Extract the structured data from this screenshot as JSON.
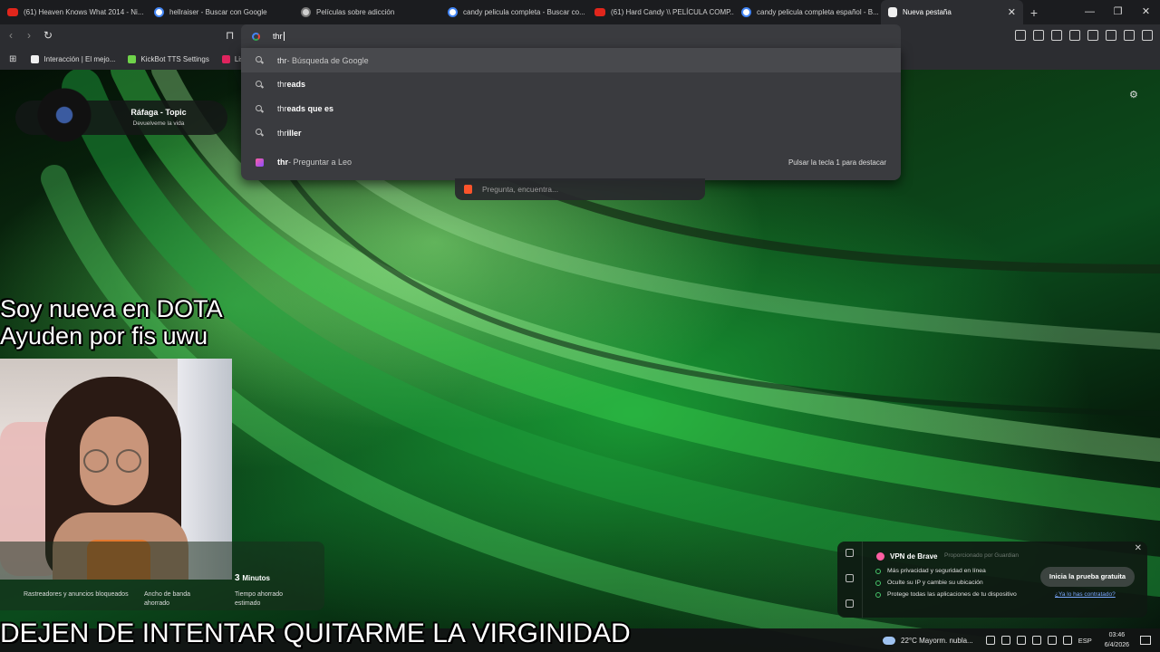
{
  "tabs": [
    {
      "label": "(61) Heaven Knows What 2014 - Ni...",
      "icon": "youtube-icon",
      "fav": "yt",
      "w": 162,
      "active": false
    },
    {
      "label": "hellraiser - Buscar con Google",
      "icon": "google-icon",
      "fav": "g",
      "w": 162,
      "active": false
    },
    {
      "label": "Películas sobre adicción",
      "icon": "page-icon",
      "fav": "grey",
      "w": 162,
      "active": false
    },
    {
      "label": "candy pelicula completa - Buscar co...",
      "icon": "google-icon",
      "fav": "g",
      "w": 162,
      "active": false
    },
    {
      "label": "(61) Hard Candy \\\\ PELÍCULA COMP...",
      "icon": "youtube-icon",
      "fav": "yt",
      "w": 162,
      "active": false
    },
    {
      "label": "candy pelicula completa español - B...",
      "icon": "google-icon",
      "fav": "g",
      "w": 162,
      "active": false
    },
    {
      "label": "Nueva pestaña",
      "icon": "brave-icon",
      "fav": "brave",
      "w": 157,
      "active": true
    }
  ],
  "omnibox": {
    "typed": "thr",
    "suggestions": [
      {
        "bold": "thr",
        "rest": "",
        "suffix": " - Búsqueda de Google"
      },
      {
        "bold": "thr",
        "rest": "eads",
        "suffix": ""
      },
      {
        "bold": "thr",
        "rest": "eads que es",
        "suffix": ""
      },
      {
        "bold": "thr",
        "rest": "iller",
        "suffix": ""
      }
    ],
    "leo": {
      "query": "thr",
      "action": " - Preguntar a Leo",
      "hint": "Pulsar la tecla 1 para destacar"
    }
  },
  "bookmarks": [
    {
      "label": "Interacción | El mejo...",
      "color": "#f0f0f0"
    },
    {
      "label": "KickBot TTS Settings",
      "color": "#6fd34a"
    },
    {
      "label": "List",
      "color": "#e0245e"
    }
  ],
  "ask_placeholder": "Pregunta, encuentra...",
  "music_widget": {
    "title": "Ráfaga - Topic",
    "subtitle": "Devuelveme la vida"
  },
  "captions": {
    "top_line1": "Soy nueva en DOTA",
    "top_line2": "Ayuden por fis uwu",
    "bottom": "DEJEN DE INTENTAR QUITARME LA VIRGINIDAD"
  },
  "stats": {
    "trackers_label": "Rastreadores y anuncios bloqueados",
    "bandwidth_label": "Ancho de banda ahorrado",
    "time_value": "3",
    "time_unit": "Minutos",
    "time_label": "Tiempo ahorrado estimado"
  },
  "vpn": {
    "title": "VPN de Brave",
    "provider": "Proporcionado por Guardian",
    "features": [
      "Más privacidad y seguridad en línea",
      "Oculte su IP y cambie su ubicación",
      "Protege todas las aplicaciones de tu dispositivo"
    ],
    "cta": "Inicia la prueba gratuita",
    "link": "¿Ya lo has contratado?"
  },
  "taskbar": {
    "weather": "22°C  Mayorm. nubla...",
    "lang": "ESP",
    "time": "03:46",
    "date": "6/4/2026"
  }
}
